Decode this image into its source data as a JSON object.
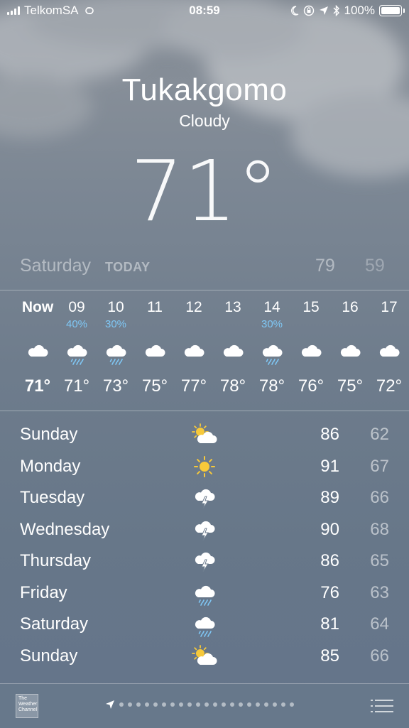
{
  "status_bar": {
    "carrier": "TelkomSA",
    "time": "08:59",
    "battery": "100%"
  },
  "location": {
    "city": "Tukakgomo",
    "condition": "Cloudy",
    "temperature": "71°"
  },
  "today": {
    "day": "Saturday",
    "tag": "TODAY",
    "high": "79",
    "low": "59"
  },
  "hourly": [
    {
      "hour": "Now",
      "pop": "",
      "icon": "cloud-icon",
      "temp": "71°"
    },
    {
      "hour": "09",
      "pop": "40%",
      "icon": "cloud-rain-icon",
      "temp": "71°"
    },
    {
      "hour": "10",
      "pop": "30%",
      "icon": "cloud-rain-icon",
      "temp": "73°"
    },
    {
      "hour": "11",
      "pop": "",
      "icon": "cloud-icon",
      "temp": "75°"
    },
    {
      "hour": "12",
      "pop": "",
      "icon": "cloud-icon",
      "temp": "77°"
    },
    {
      "hour": "13",
      "pop": "",
      "icon": "cloud-icon",
      "temp": "78°"
    },
    {
      "hour": "14",
      "pop": "30%",
      "icon": "cloud-rain-icon",
      "temp": "78°"
    },
    {
      "hour": "15",
      "pop": "",
      "icon": "cloud-icon",
      "temp": "76°"
    },
    {
      "hour": "16",
      "pop": "",
      "icon": "cloud-icon",
      "temp": "75°"
    },
    {
      "hour": "17",
      "pop": "",
      "icon": "cloud-icon",
      "temp": "72°"
    }
  ],
  "daily": [
    {
      "day": "Sunday",
      "icon": "partly-sunny-icon",
      "high": "86",
      "low": "62"
    },
    {
      "day": "Monday",
      "icon": "sun-icon",
      "high": "91",
      "low": "67"
    },
    {
      "day": "Tuesday",
      "icon": "thunderstorm-icon",
      "high": "89",
      "low": "66"
    },
    {
      "day": "Wednesday",
      "icon": "thunderstorm-icon",
      "high": "90",
      "low": "68"
    },
    {
      "day": "Thursday",
      "icon": "thunderstorm-icon",
      "high": "86",
      "low": "65"
    },
    {
      "day": "Friday",
      "icon": "cloud-rain-icon",
      "high": "76",
      "low": "63"
    },
    {
      "day": "Saturday",
      "icon": "cloud-rain-icon",
      "high": "81",
      "low": "64"
    },
    {
      "day": "Sunday",
      "icon": "partly-sunny-icon",
      "high": "85",
      "low": "66"
    }
  ],
  "bottom_bar": {
    "logo_text": "The Weather Channel",
    "page_dots": 21
  },
  "colors": {
    "precip_blue": "#7fc7f5",
    "sun_yellow": "#f7c93a"
  }
}
